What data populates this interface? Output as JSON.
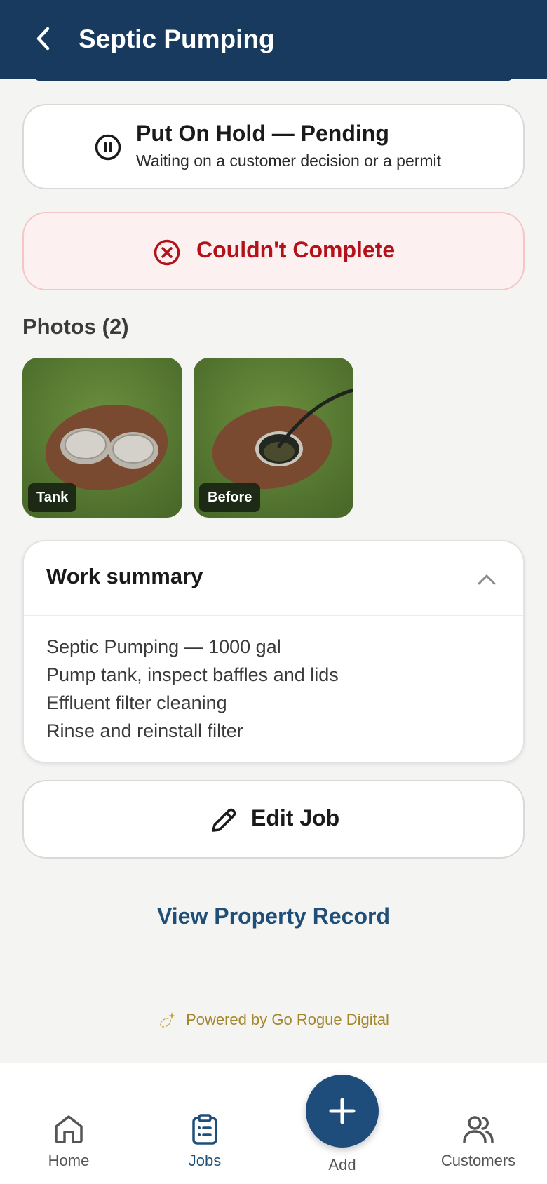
{
  "header": {
    "title": "Septic Pumping"
  },
  "hold_button": {
    "title": "Put On Hold — Pending",
    "subtitle": "Waiting on a customer decision or a permit"
  },
  "fail_button": {
    "label": "Couldn't Complete"
  },
  "photos": {
    "title": "Photos (2)",
    "items": [
      {
        "label": "Tank"
      },
      {
        "label": "Before"
      }
    ]
  },
  "work_summary": {
    "title": "Work summary",
    "lines": [
      "Septic Pumping — 1000 gal",
      "Pump tank, inspect baffles and lids",
      "Effluent filter cleaning",
      "Rinse and reinstall filter"
    ]
  },
  "edit_button": {
    "label": "Edit Job"
  },
  "property_link": {
    "label": "View Property Record"
  },
  "footer": {
    "powered_by": "Powered by Go Rogue Digital"
  },
  "tabbar": {
    "items": [
      {
        "label": "Home",
        "icon": "home-icon"
      },
      {
        "label": "Jobs",
        "icon": "clipboard-icon"
      },
      {
        "label": "Add",
        "icon": "plus-icon"
      },
      {
        "label": "Customers",
        "icon": "users-icon"
      }
    ]
  },
  "colors": {
    "header_bg": "#173a5e",
    "accent": "#1f4e79",
    "danger": "#b3121a",
    "danger_bg": "#fdf0f0",
    "brand_gold": "#a3872a"
  }
}
